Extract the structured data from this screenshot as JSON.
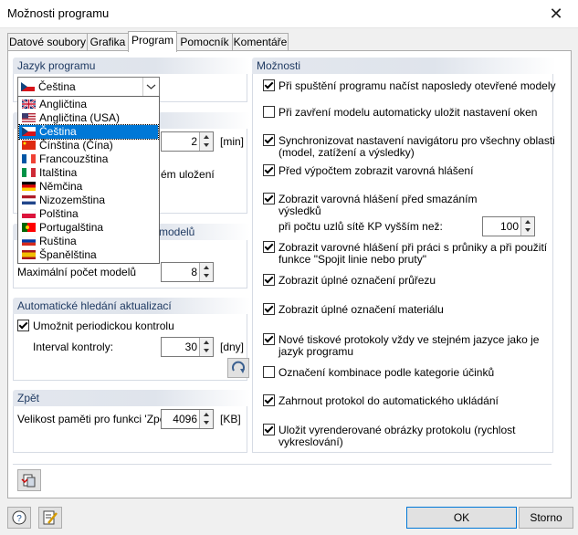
{
  "window": {
    "title": "Možnosti programu",
    "close_glyph": "✕"
  },
  "tabs": [
    {
      "label": "Datové soubory"
    },
    {
      "label": "Grafika"
    },
    {
      "label": "Program"
    },
    {
      "label": "Pomocník"
    },
    {
      "label": "Komentáře"
    }
  ],
  "language": {
    "header": "Jazyk programu",
    "selected": "Čeština",
    "options": [
      "Angličtina",
      "Angličtina (USA)",
      "Čeština",
      "Čínština (Čína)",
      "Francouzština",
      "Italština",
      "Němčina",
      "Nizozemština",
      "Polština",
      "Portugalština",
      "Ruština",
      "Španělština"
    ],
    "selected_index": 2
  },
  "autosave": {
    "value": "2",
    "unit": "[min]",
    "partial_text": "ém uložení"
  },
  "models": {
    "header_partial": "modelů",
    "max_label": "Maximální počet modelů",
    "max_value": "8"
  },
  "updates": {
    "header": "Automatické hledání aktualizací",
    "enable_label": "Umožnit periodickou kontrolu",
    "interval_label": "Interval kontroly:",
    "interval_value": "30",
    "interval_unit": "[dny]"
  },
  "undo": {
    "header": "Zpět",
    "label": "Velikost paměti pro funkci 'Zpět':",
    "value": "4096",
    "unit": "[KB]"
  },
  "options": {
    "header": "Možnosti",
    "items": [
      {
        "label": "Při spuštění programu načíst naposledy otevřené modely",
        "checked": true
      },
      {
        "label": "Při zavření modelu  automaticky uložit nastavení oken",
        "checked": false
      },
      {
        "label": "Synchronizovat nastavení navigátoru pro všechny oblasti",
        "label2": "(model, zatížení a výsledky)",
        "checked": true
      },
      {
        "label": "Před výpočtem zobrazit varovná hlášení",
        "checked": true
      },
      {
        "label": "Zobrazit varovná hlášení před smazáním",
        "label2": "výsledků",
        "checked": true
      },
      {
        "label": "Zobrazit varovné hlášení při práci s průniky a při použití",
        "label2": "funkce \"Spojit linie nebo pruty\"",
        "checked": true
      },
      {
        "label": "Zobrazit úplné označení průřezu",
        "checked": true
      },
      {
        "label": "Zobrazit úplné označení materiálu",
        "checked": true
      },
      {
        "label": "Nové tiskové protokoly vždy ve stejném jazyce jako je",
        "label2": "jazyk programu",
        "checked": true
      },
      {
        "label": "Označení kombinace podle kategorie účinků",
        "checked": false
      },
      {
        "label": "Zahrnout protokol do automatického ukládání",
        "checked": true
      },
      {
        "label": "Uložit vyrenderované obrázky protokolu (rychlost",
        "label2": "vykreslování)",
        "checked": true
      }
    ],
    "node_count_label": "při počtu uzlů sítě KP vyšším než:",
    "node_count_value": "100"
  },
  "buttons": {
    "ok": "OK",
    "cancel": "Storno"
  },
  "icons": [
    "reset-icon",
    "help-icon",
    "edit-icon",
    "defaults-icon"
  ]
}
